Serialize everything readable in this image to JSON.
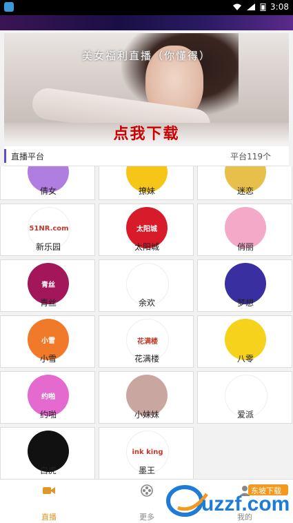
{
  "status_bar": {
    "time": "3:08"
  },
  "banner": {
    "headline": "美女福利直播（你懂得）",
    "cta": "点我下载"
  },
  "platform_header": {
    "title": "直播平台",
    "count": "平台119个"
  },
  "platforms": [
    {
      "name": "倩女",
      "color": "#b07de0"
    },
    {
      "name": "撩妹",
      "color": "#f5c518"
    },
    {
      "name": "迷恋",
      "color": "#e6c04a"
    },
    {
      "name": "新乐园",
      "color": "#ffffff",
      "logo_text": "51NR.com"
    },
    {
      "name": "太阳城",
      "color": "#d81b2b",
      "logo_text": "太阳城"
    },
    {
      "name": "俏丽",
      "color": "#f4a9c9"
    },
    {
      "name": "青丝",
      "color": "#a3165a",
      "logo_text": "青丝"
    },
    {
      "name": "余欢",
      "color": "#ffffff"
    },
    {
      "name": "梦想",
      "color": "#3a2fa0"
    },
    {
      "name": "小雪",
      "color": "#f07a2a",
      "logo_text": "小雪"
    },
    {
      "name": "花满楼",
      "color": "#ffffff",
      "logo_text": "花满楼"
    },
    {
      "name": "八零",
      "color": "#f6d21c"
    },
    {
      "name": "约啪",
      "color": "#e56ad0",
      "logo_text": "约啪"
    },
    {
      "name": "小妹妹",
      "color": "#c9a7a0"
    },
    {
      "name": "爱派",
      "color": "#ffffff"
    },
    {
      "name": "白虎",
      "color": "#111111"
    },
    {
      "name": "墨王",
      "color": "#ffffff",
      "logo_text": "ink king"
    }
  ],
  "tabs": [
    {
      "label": "直播",
      "icon": "video-camera-icon",
      "active": true
    },
    {
      "label": "更多",
      "icon": "film-reel-icon",
      "active": false
    },
    {
      "label": "我的",
      "icon": "user-icon",
      "active": false
    }
  ],
  "watermark": {
    "text": "uzzf.com",
    "subtext": "东坡下载"
  }
}
